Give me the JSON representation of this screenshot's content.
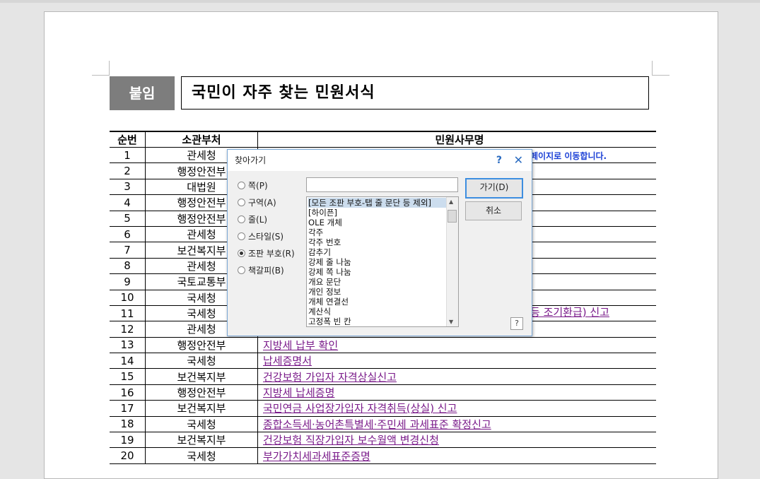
{
  "document": {
    "attach_label": "붙임",
    "title": "국민이 자주 찾는 민원서식",
    "header": {
      "no": "순번",
      "dept": "소관부처",
      "name": "민원사무명"
    },
    "note": "페이지로 이동합니다.",
    "trailing_text": "등 조기환급) 신고",
    "rows": [
      {
        "no": "1",
        "dept": "관세청",
        "name": ""
      },
      {
        "no": "2",
        "dept": "행정안전부",
        "name": ""
      },
      {
        "no": "3",
        "dept": "대법원",
        "name": ""
      },
      {
        "no": "4",
        "dept": "행정안전부",
        "name": ""
      },
      {
        "no": "5",
        "dept": "행정안전부",
        "name": ""
      },
      {
        "no": "6",
        "dept": "관세청",
        "name": ""
      },
      {
        "no": "7",
        "dept": "보건복지부",
        "name": ""
      },
      {
        "no": "8",
        "dept": "관세청",
        "name": ""
      },
      {
        "no": "9",
        "dept": "국토교통부",
        "name": ""
      },
      {
        "no": "10",
        "dept": "국세청",
        "name": ""
      },
      {
        "no": "11",
        "dept": "국세청",
        "name": ""
      },
      {
        "no": "12",
        "dept": "관세청",
        "name": ""
      },
      {
        "no": "13",
        "dept": "행정안전부",
        "name": "지방세 납부 확인"
      },
      {
        "no": "14",
        "dept": "국세청",
        "name": "납세증명서"
      },
      {
        "no": "15",
        "dept": "보건복지부",
        "name": "건강보험 가입자 자격상실신고"
      },
      {
        "no": "16",
        "dept": "행정안전부",
        "name": "지방세 납세증명"
      },
      {
        "no": "17",
        "dept": "보건복지부",
        "name": "국민연금 사업장가입자 자격취득(상실) 신고"
      },
      {
        "no": "18",
        "dept": "국세청",
        "name": "종합소득세·농어촌특별세·주민세 과세표준 확정신고"
      },
      {
        "no": "19",
        "dept": "보건복지부",
        "name": "건강보험 직장가입자 보수월액 변경신청"
      },
      {
        "no": "20",
        "dept": "국세청",
        "name": "부가가치세과세표준증명"
      }
    ]
  },
  "dialog": {
    "title": "찾아가기",
    "help_label": "?",
    "close_label": "✕",
    "radios": [
      {
        "label": "쪽(P)",
        "selected": false
      },
      {
        "label": "구역(A)",
        "selected": false
      },
      {
        "label": "줄(L)",
        "selected": false
      },
      {
        "label": "스타일(S)",
        "selected": false
      },
      {
        "label": "조판 부호(R)",
        "selected": true
      },
      {
        "label": "책갈피(B)",
        "selected": false
      }
    ],
    "search_value": "",
    "list_items": [
      "[모든 조판 부호-탭 줄 문단 등 제외]",
      "[하이픈]",
      "OLE 개체",
      "각주",
      "각주 번호",
      "감추기",
      "강제 줄 나눔",
      "강제 쪽 나눔",
      "개요 문단",
      "개인 정보",
      "개체 연결선",
      "계산식",
      "고정폭 빈 칸"
    ],
    "go_button": "가기(D)",
    "cancel_button": "취소",
    "bottom_help": "?"
  }
}
